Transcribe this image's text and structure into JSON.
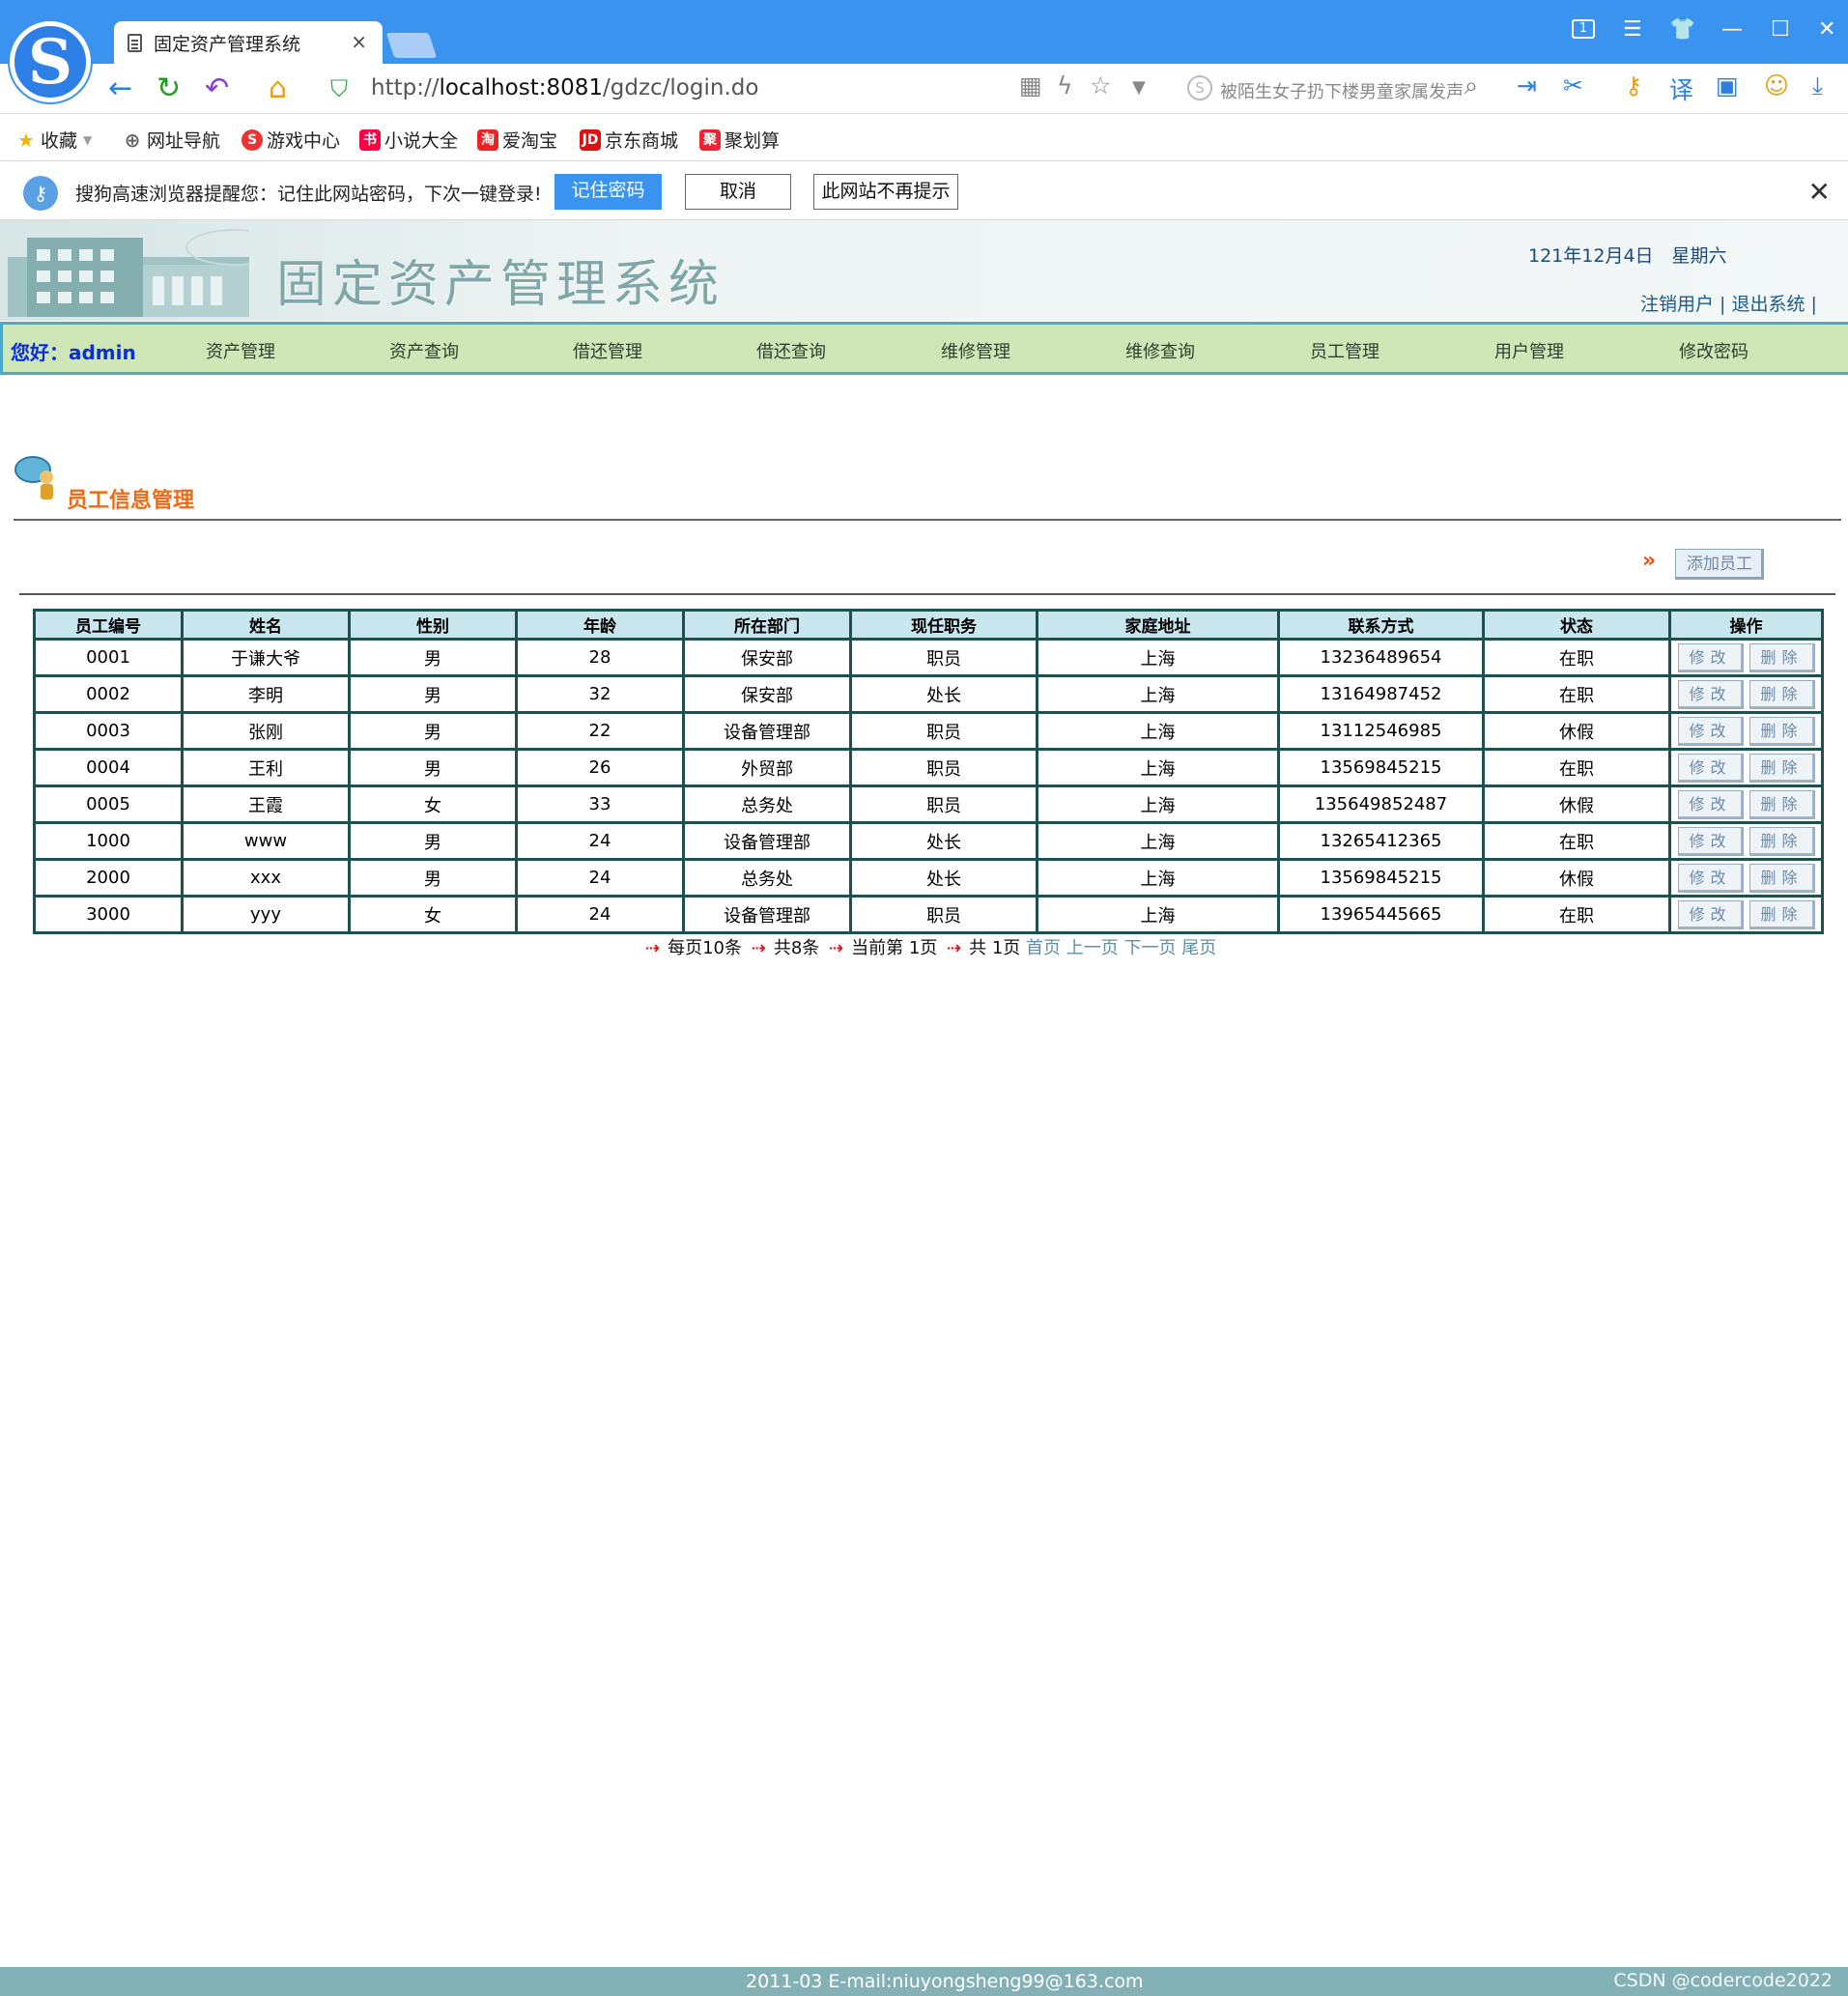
{
  "browser": {
    "tab_title": "固定资产管理系统",
    "tab_close": "×",
    "url_prefix": "http://",
    "url_host": "localhost:8081",
    "url_path": "/gdzc/login.do",
    "search_placeholder": "被陌生女子扔下楼男童家属发声",
    "window_ctl_page": "1",
    "bookmarks": [
      "收藏",
      "网址导航",
      "游戏中心",
      "小说大全",
      "爱淘宝",
      "京东商城",
      "聚划算"
    ]
  },
  "password_bar": {
    "message": "搜狗高速浏览器提醒您：记住此网站密码，下次一键登录!",
    "remember_label": "记住密码",
    "cancel_label": "取消",
    "never_label": "此网站不再提示"
  },
  "header": {
    "system_title": "固定资产管理系统",
    "date": "121年12月4日　星期六",
    "logout_links": "注销用户 | 退出系统 |"
  },
  "menu": {
    "greeting": "您好：admin",
    "items": [
      "资产管理",
      "资产查询",
      "借还管理",
      "借还查询",
      "维修管理",
      "维修查询",
      "员工管理",
      "用户管理",
      "修改密码"
    ]
  },
  "section": {
    "title": "员工信息管理",
    "add_button": "添加员工"
  },
  "table": {
    "columns": [
      "员工编号",
      "姓名",
      "性别",
      "年龄",
      "所在部门",
      "现任职务",
      "家庭地址",
      "联系方式",
      "状态",
      "操作"
    ],
    "edit_label": "修改",
    "delete_label": "删除",
    "rows": [
      {
        "id": "0001",
        "name": "于谦大爷",
        "gender": "男",
        "age": "28",
        "dept": "保安部",
        "title": "职员",
        "address": "上海",
        "phone": "13236489654",
        "status": "在职"
      },
      {
        "id": "0002",
        "name": "李明",
        "gender": "男",
        "age": "32",
        "dept": "保安部",
        "title": "处长",
        "address": "上海",
        "phone": "13164987452",
        "status": "在职"
      },
      {
        "id": "0003",
        "name": "张刚",
        "gender": "男",
        "age": "22",
        "dept": "设备管理部",
        "title": "职员",
        "address": "上海",
        "phone": "13112546985",
        "status": "休假"
      },
      {
        "id": "0004",
        "name": "王利",
        "gender": "男",
        "age": "26",
        "dept": "外贸部",
        "title": "职员",
        "address": "上海",
        "phone": "13569845215",
        "status": "在职"
      },
      {
        "id": "0005",
        "name": "王霞",
        "gender": "女",
        "age": "33",
        "dept": "总务处",
        "title": "职员",
        "address": "上海",
        "phone": "135649852487",
        "status": "休假"
      },
      {
        "id": "1000",
        "name": "www",
        "gender": "男",
        "age": "24",
        "dept": "设备管理部",
        "title": "处长",
        "address": "上海",
        "phone": "13265412365",
        "status": "在职"
      },
      {
        "id": "2000",
        "name": "xxx",
        "gender": "男",
        "age": "24",
        "dept": "总务处",
        "title": "处长",
        "address": "上海",
        "phone": "13569845215",
        "status": "休假"
      },
      {
        "id": "3000",
        "name": "yyy",
        "gender": "女",
        "age": "24",
        "dept": "设备管理部",
        "title": "职员",
        "address": "上海",
        "phone": "13965445665",
        "status": "在职"
      }
    ]
  },
  "pager": {
    "per_page": "每页10条",
    "total": "共8条",
    "current": "当前第 1页",
    "pages": "共 1页",
    "first": "首页",
    "prev": "上一页",
    "next": "下一页",
    "last": "尾页"
  },
  "footer": {
    "text": "2011-03 E-mail:niuyongsheng99@163.com",
    "watermark": "CSDN @codercode2022"
  },
  "colors": {
    "browser_blue": "#3b93f0",
    "menu_bg": "#cfe6b6",
    "table_border": "#1f4f4f",
    "header_cell": "#c9e6ee",
    "section_title": "#f06a14",
    "footer_bg": "#83b1b6"
  }
}
